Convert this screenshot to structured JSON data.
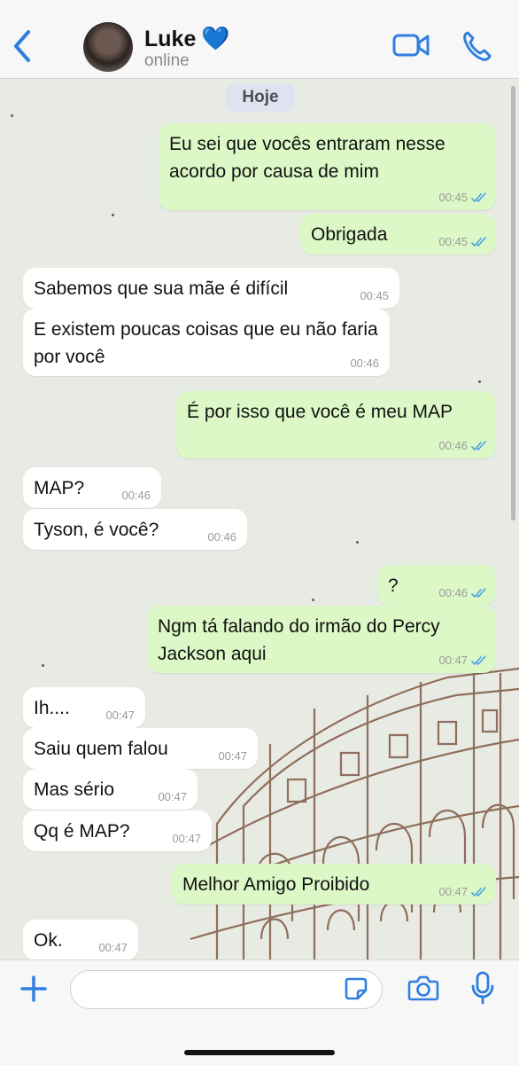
{
  "header": {
    "contact_name": "Luke",
    "heart": "💙",
    "status": "online"
  },
  "chat": {
    "day_label": "Hoje",
    "messages": [
      {
        "direction": "out",
        "text": "Eu sei que vocês entraram nesse acordo por causa de mim",
        "time": "00:45",
        "read": true
      },
      {
        "direction": "out",
        "text": "Obrigada",
        "time": "00:45",
        "read": true
      },
      {
        "direction": "in",
        "text": "Sabemos que sua mãe é difícil",
        "time": "00:45"
      },
      {
        "direction": "in",
        "text": "E existem poucas coisas que eu não faria por você",
        "time": "00:46"
      },
      {
        "direction": "out",
        "text": "É por isso que você é meu MAP",
        "time": "00:46",
        "read": true
      },
      {
        "direction": "in",
        "text": "MAP?",
        "time": "00:46"
      },
      {
        "direction": "in",
        "text": "Tyson, é você?",
        "time": "00:46"
      },
      {
        "direction": "out",
        "text": "?",
        "time": "00:46",
        "read": true
      },
      {
        "direction": "out",
        "text": "Ngm tá falando do irmão do Percy Jackson aqui",
        "time": "00:47",
        "read": true
      },
      {
        "direction": "in",
        "text": "Ih....",
        "time": "00:47"
      },
      {
        "direction": "in",
        "text": "Saiu quem falou",
        "time": "00:47"
      },
      {
        "direction": "in",
        "text": "Mas sério",
        "time": "00:47"
      },
      {
        "direction": "in",
        "text": "Qq é MAP?",
        "time": "00:47"
      },
      {
        "direction": "out",
        "text": "Melhor Amigo Proibido",
        "time": "00:47",
        "read": true
      },
      {
        "direction": "in",
        "text": "Ok.",
        "time": "00:47"
      }
    ]
  },
  "footer": {
    "input_placeholder": ""
  },
  "colors": {
    "accent": "#2f7fe0",
    "outgoing_bubble": "#dcf8c6",
    "incoming_bubble": "#ffffff",
    "read_tick": "#4aa3e6",
    "wallpaper": "#e7ebe4"
  },
  "icons": [
    "back-chevron-icon",
    "video-call-icon",
    "phone-icon",
    "plus-icon",
    "sticker-icon",
    "camera-icon",
    "microphone-icon",
    "read-ticks-icon"
  ]
}
